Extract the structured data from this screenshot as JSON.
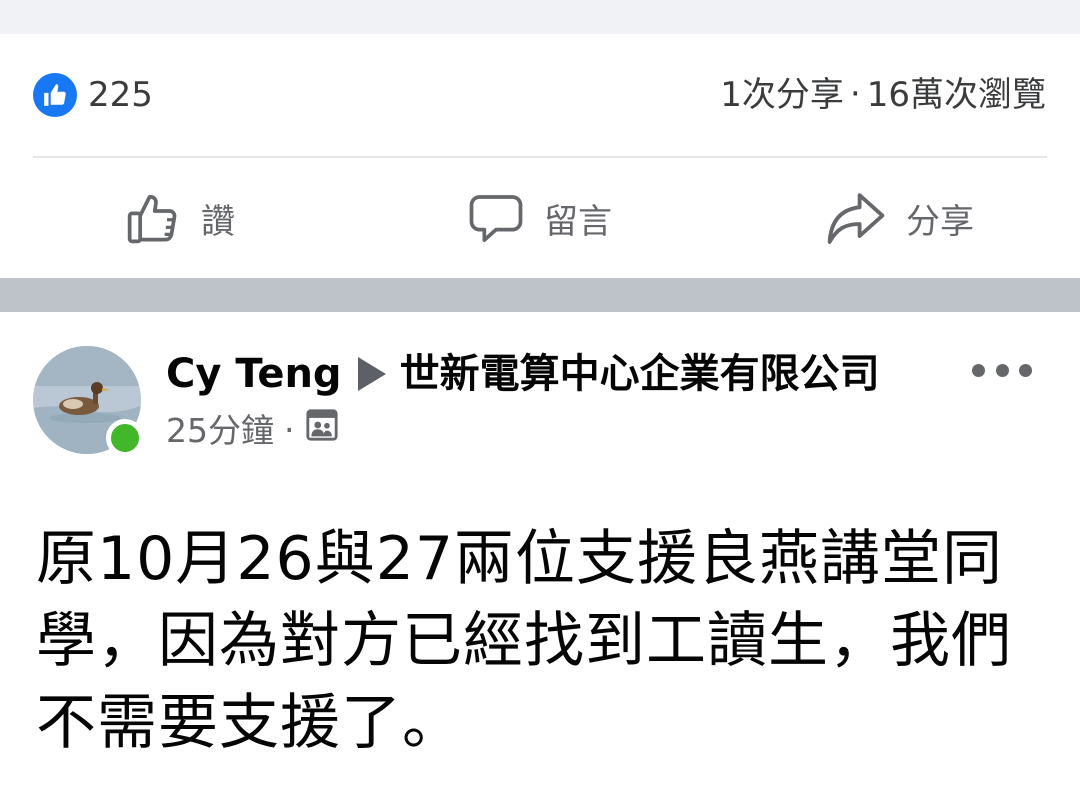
{
  "reactions": {
    "like_icon": "thumbs-up-icon",
    "like_count": "225",
    "shares": "1次分享",
    "separator": "‧",
    "views": "16萬次瀏覽"
  },
  "actions": [
    {
      "icon": "thumbs-up-outline-icon",
      "label": "讚"
    },
    {
      "icon": "comment-bubble-icon",
      "label": "留言"
    },
    {
      "icon": "share-arrow-icon",
      "label": "分享"
    }
  ],
  "post": {
    "author": "Cy Teng",
    "group": "世新電算中心企業有限公司",
    "time": "25分鐘",
    "separator": "‧",
    "audience_icon": "group-audience-icon",
    "text": "原10月26與27兩位支援良燕講堂同學，因為對方已經找到工讀生，我們不需要支援了。"
  },
  "colors": {
    "like_blue": "#1877f2",
    "online_green": "#42b72a",
    "separator_gray": "#bec3c9",
    "icon_gray": "#65676b"
  }
}
